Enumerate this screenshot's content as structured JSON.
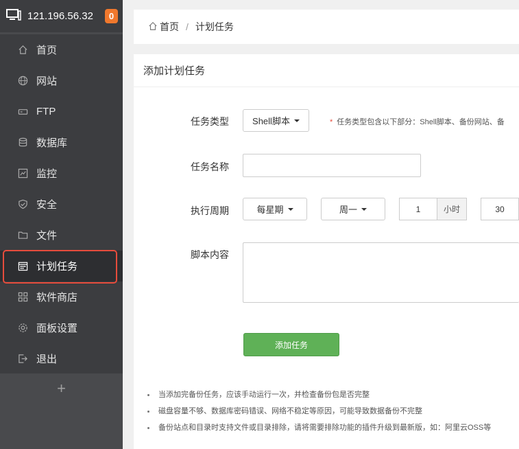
{
  "sidebar": {
    "server_ip": "121.196.56.32",
    "badge": "0",
    "items": [
      {
        "label": "首页",
        "icon": "home-icon"
      },
      {
        "label": "网站",
        "icon": "globe-icon"
      },
      {
        "label": "FTP",
        "icon": "ftp-icon"
      },
      {
        "label": "数据库",
        "icon": "database-icon"
      },
      {
        "label": "监控",
        "icon": "monitor-icon"
      },
      {
        "label": "安全",
        "icon": "shield-icon"
      },
      {
        "label": "文件",
        "icon": "folder-icon"
      },
      {
        "label": "计划任务",
        "icon": "calendar-icon",
        "active": true
      },
      {
        "label": "软件商店",
        "icon": "grid-icon"
      },
      {
        "label": "面板设置",
        "icon": "gear-icon"
      },
      {
        "label": "退出",
        "icon": "logout-icon"
      }
    ],
    "add_label": "+"
  },
  "breadcrumb": {
    "home": "首页",
    "separator": "/",
    "current": "计划任务"
  },
  "panel": {
    "title": "添加计划任务",
    "task_type_label": "任务类型",
    "task_type_value": "Shell脚本",
    "task_type_hint_star": "*",
    "task_type_hint": "任务类型包含以下部分：Shell脚本、备份网站、备",
    "task_name_label": "任务名称",
    "task_name_value": "",
    "period_label": "执行周期",
    "period_value": "每星期",
    "weekday_value": "周一",
    "hour_value": "1",
    "hour_unit": "小时",
    "minute_value": "30",
    "script_label": "脚本内容",
    "script_value": "",
    "submit_label": "添加任务",
    "notes": [
      "当添加完备份任务，应该手动运行一次，并检查备份包是否完整",
      "磁盘容量不够、数据库密码错误、网络不稳定等原因，可能导致数据备份不完整",
      "备份站点和目录时支持文件或目录排除，请将需要排除功能的插件升级到最新版，如：阿里云OSS等"
    ]
  },
  "colors": {
    "sidebar_bg": "#3c3d40",
    "badge": "#f0782d",
    "active_outline": "#e74c3c",
    "submit": "#5fb157"
  }
}
